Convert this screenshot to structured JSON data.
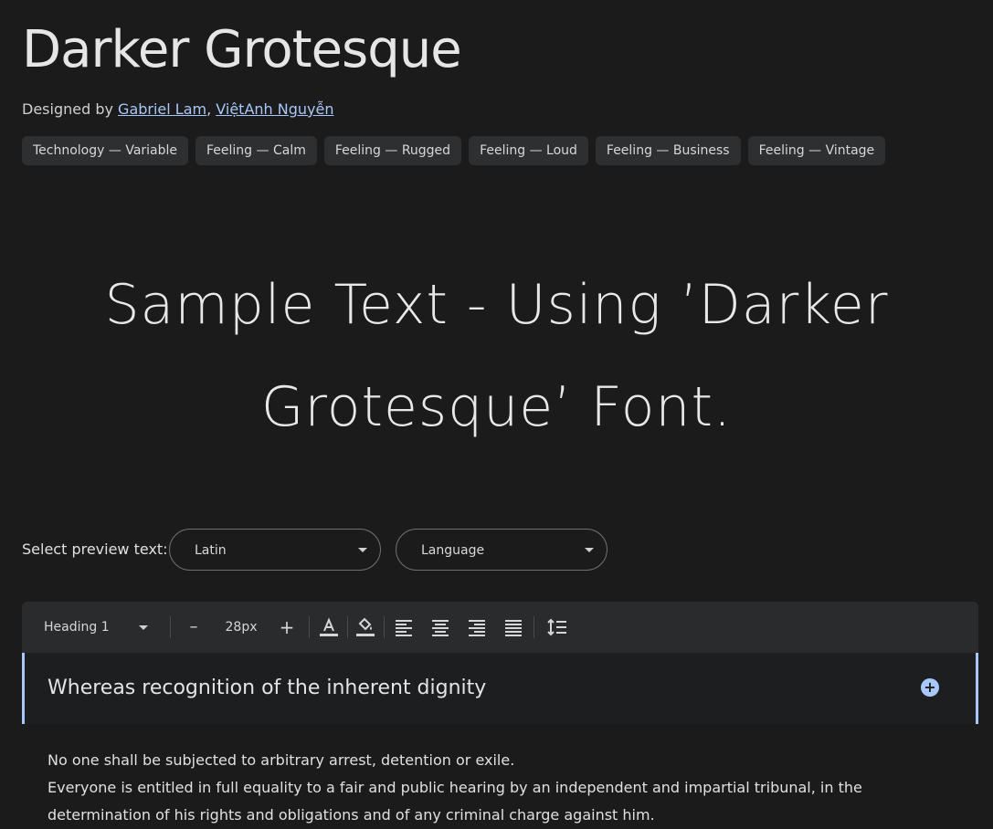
{
  "font": {
    "title": "Darker Grotesque",
    "designed_by_prefix": "Designed by",
    "designers": [
      "Gabriel Lam",
      "ViệtAnh Nguyễn"
    ],
    "tags": [
      "Technology — Variable",
      "Feeling — Calm",
      "Feeling — Rugged",
      "Feeling — Loud",
      "Feeling — Business",
      "Feeling — Vintage"
    ]
  },
  "sample": {
    "line1": "Sample Text - Using ’Darker",
    "line2": "Grotesque’ Font."
  },
  "preview": {
    "label": "Select preview text:",
    "script_value": "Latin",
    "language_value": "Language"
  },
  "toolbar": {
    "style_value": "Heading 1",
    "size_value": "28px",
    "decrease_label": "–",
    "increase_label": "+"
  },
  "editor": {
    "heading": "Whereas recognition of the inherent dignity",
    "paragraph_lines": [
      "No one shall be subjected to arbitrary arrest, detention or exile.",
      "Everyone is entitled in full equality to a fair and public hearing by an independent and impartial tribunal, in the",
      "determination of his rights and obligations and of any criminal charge against him."
    ]
  },
  "colors": {
    "background": "#1b1b1b",
    "accent": "#a8c7fa",
    "toolbar": "#2a2b2d"
  }
}
